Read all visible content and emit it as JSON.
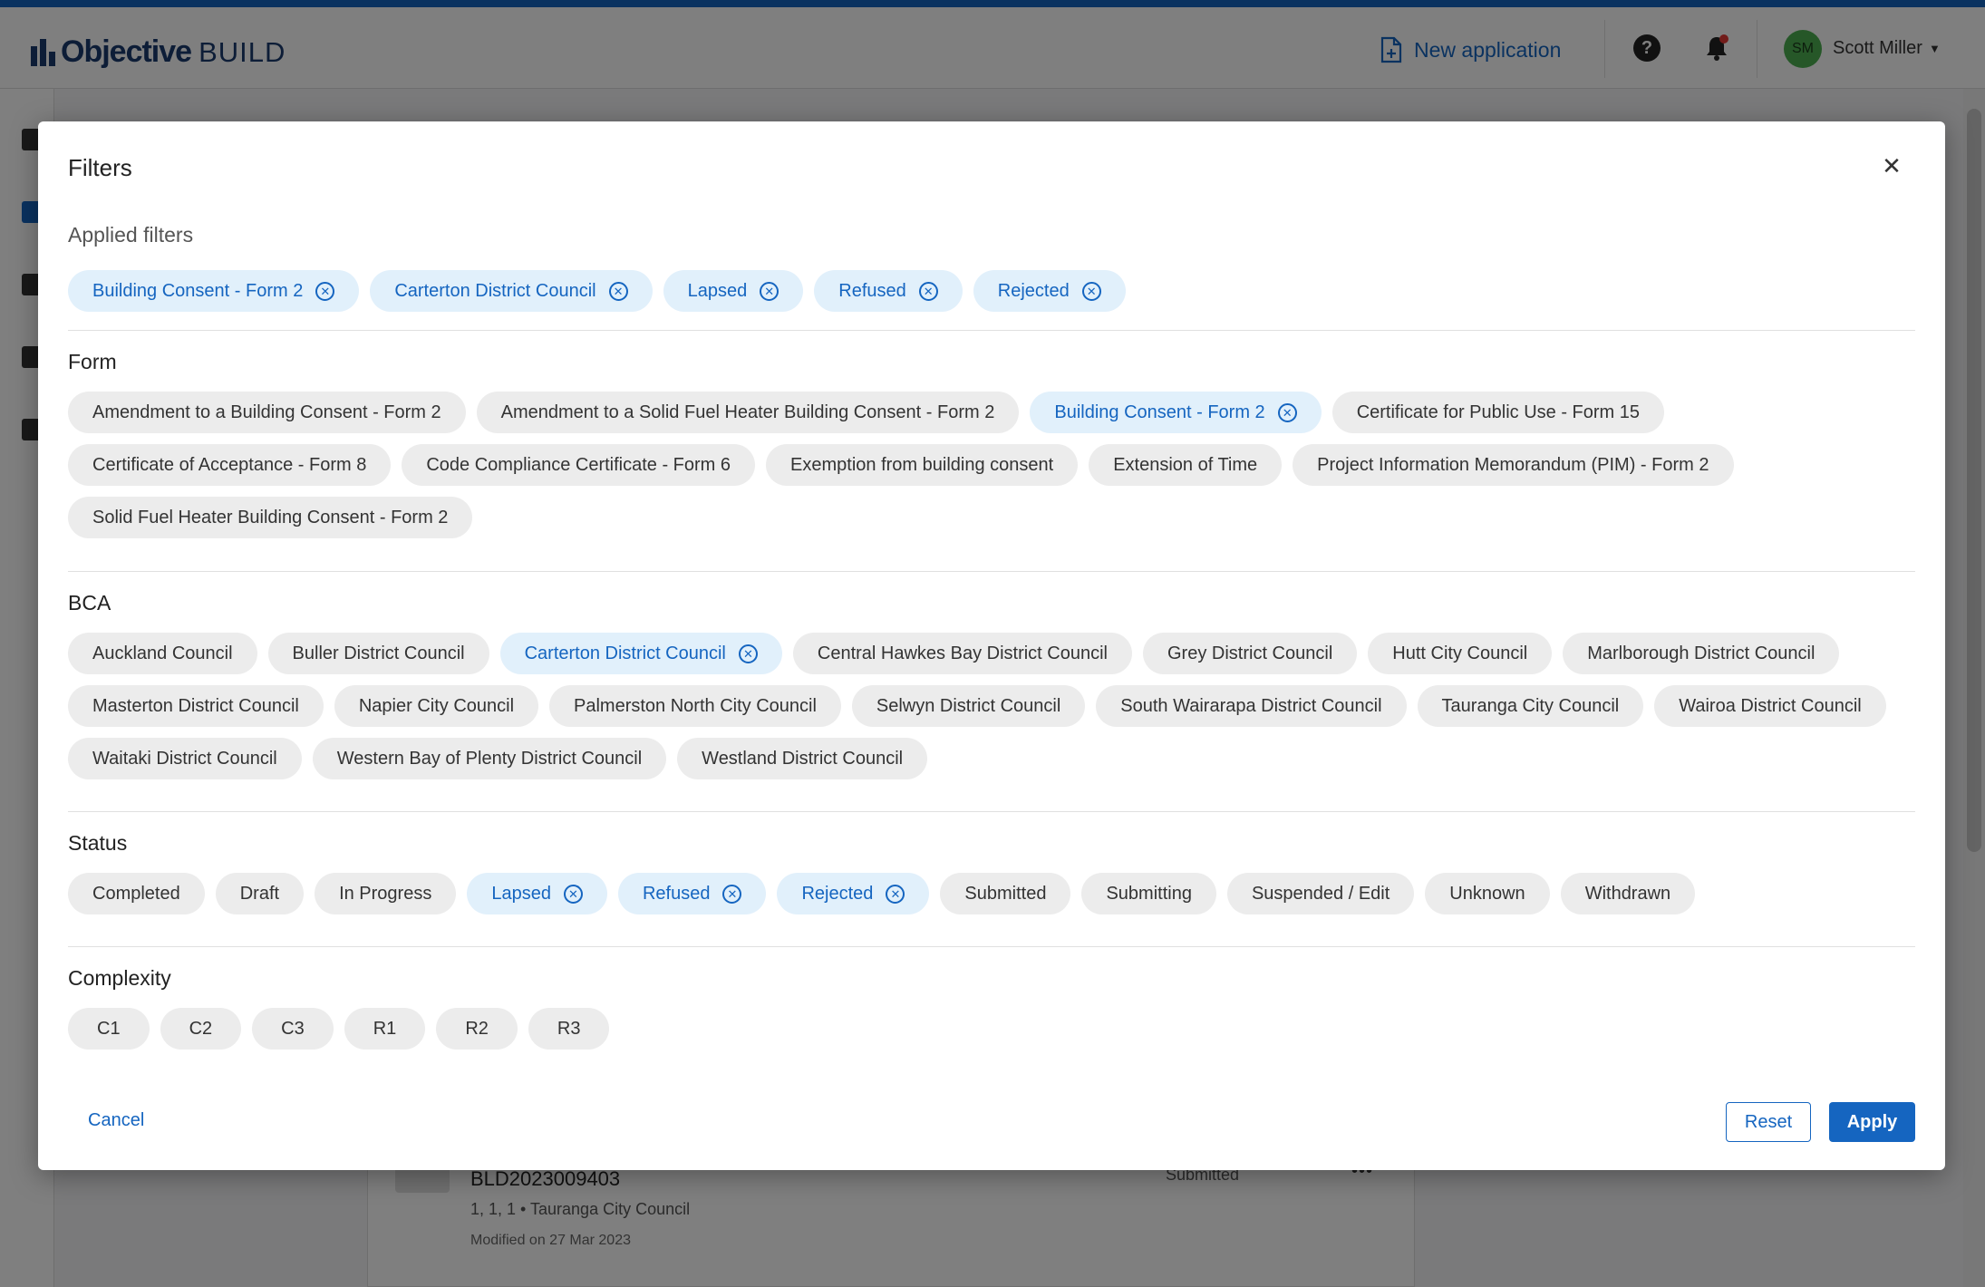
{
  "app": {
    "logo_text": "Objective",
    "logo_sub": "BUILD",
    "new_application_label": "New application",
    "user_initials": "SM",
    "user_name": "Scott Miller"
  },
  "background_card": {
    "id": "BLD2023009403",
    "subtitle": "1, 1, 1 • Tauranga City Council",
    "modified": "Modified on 27 Mar 2023",
    "status": "Submitted"
  },
  "modal": {
    "title": "Filters",
    "applied_title": "Applied filters",
    "applied": [
      {
        "label": "Building Consent - Form 2"
      },
      {
        "label": "Carterton District Council"
      },
      {
        "label": "Lapsed"
      },
      {
        "label": "Refused"
      },
      {
        "label": "Rejected"
      }
    ],
    "sections": {
      "form": {
        "title": "Form",
        "options": [
          {
            "label": "Amendment to a Building Consent - Form 2",
            "selected": false
          },
          {
            "label": "Amendment to a Solid Fuel Heater Building Consent - Form 2",
            "selected": false
          },
          {
            "label": "Building Consent - Form 2",
            "selected": true
          },
          {
            "label": "Certificate for Public Use - Form 15",
            "selected": false
          },
          {
            "label": "Certificate of Acceptance - Form 8",
            "selected": false
          },
          {
            "label": "Code Compliance Certificate - Form 6",
            "selected": false
          },
          {
            "label": "Exemption from building consent",
            "selected": false
          },
          {
            "label": "Extension of Time",
            "selected": false
          },
          {
            "label": "Project Information Memorandum (PIM) - Form 2",
            "selected": false
          },
          {
            "label": "Solid Fuel Heater Building Consent - Form 2",
            "selected": false
          }
        ]
      },
      "bca": {
        "title": "BCA",
        "options": [
          {
            "label": "Auckland Council",
            "selected": false
          },
          {
            "label": "Buller District Council",
            "selected": false
          },
          {
            "label": "Carterton District Council",
            "selected": true
          },
          {
            "label": "Central Hawkes Bay District Council",
            "selected": false
          },
          {
            "label": "Grey District Council",
            "selected": false
          },
          {
            "label": "Hutt City Council",
            "selected": false
          },
          {
            "label": "Marlborough District Council",
            "selected": false
          },
          {
            "label": "Masterton District Council",
            "selected": false
          },
          {
            "label": "Napier City Council",
            "selected": false
          },
          {
            "label": "Palmerston North City Council",
            "selected": false
          },
          {
            "label": "Selwyn District Council",
            "selected": false
          },
          {
            "label": "South Wairarapa District Council",
            "selected": false
          },
          {
            "label": "Tauranga City Council",
            "selected": false
          },
          {
            "label": "Wairoa District Council",
            "selected": false
          },
          {
            "label": "Waitaki District Council",
            "selected": false
          },
          {
            "label": "Western Bay of Plenty District Council",
            "selected": false
          },
          {
            "label": "Westland District Council",
            "selected": false
          }
        ]
      },
      "status": {
        "title": "Status",
        "options": [
          {
            "label": "Completed",
            "selected": false
          },
          {
            "label": "Draft",
            "selected": false
          },
          {
            "label": "In Progress",
            "selected": false
          },
          {
            "label": "Lapsed",
            "selected": true
          },
          {
            "label": "Refused",
            "selected": true
          },
          {
            "label": "Rejected",
            "selected": true
          },
          {
            "label": "Submitted",
            "selected": false
          },
          {
            "label": "Submitting",
            "selected": false
          },
          {
            "label": "Suspended / Edit",
            "selected": false
          },
          {
            "label": "Unknown",
            "selected": false
          },
          {
            "label": "Withdrawn",
            "selected": false
          }
        ]
      },
      "complexity": {
        "title": "Complexity",
        "options": [
          {
            "label": "C1",
            "selected": false
          },
          {
            "label": "C2",
            "selected": false
          },
          {
            "label": "C3",
            "selected": false
          },
          {
            "label": "R1",
            "selected": false
          },
          {
            "label": "R2",
            "selected": false
          },
          {
            "label": "R3",
            "selected": false
          }
        ]
      }
    },
    "cancel_label": "Cancel",
    "reset_label": "Reset",
    "apply_label": "Apply"
  },
  "colors": {
    "accent": "#1565c0",
    "selected_chip_bg": "#e1f0fb",
    "chip_bg": "#ececec"
  },
  "icons": {
    "remove_chip": "close-circle-icon",
    "close": "close-icon",
    "help": "help-circle-icon",
    "notifications": "bell-icon",
    "new_application": "file-plus-icon"
  }
}
